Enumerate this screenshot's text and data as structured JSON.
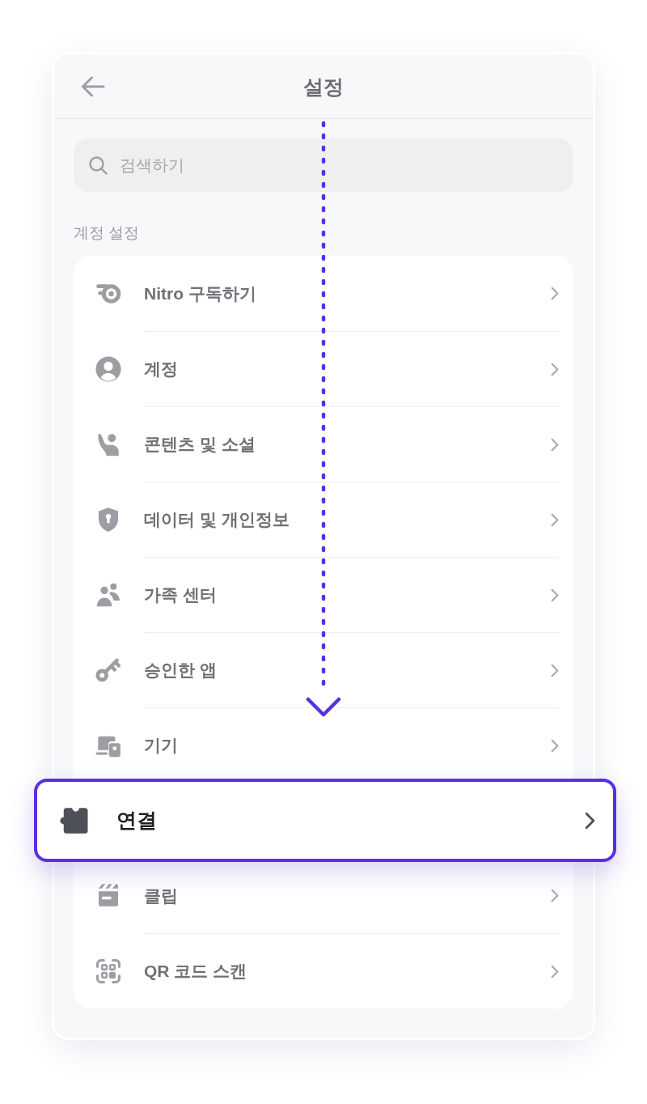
{
  "header": {
    "title": "설정"
  },
  "search": {
    "placeholder": "검색하기"
  },
  "section": {
    "title": "계정 설정",
    "items": [
      {
        "label": "Nitro 구독하기",
        "selected": false
      },
      {
        "label": "계정",
        "selected": false
      },
      {
        "label": "콘텐츠 및 소셜",
        "selected": false
      },
      {
        "label": "데이터 및 개인정보",
        "selected": false
      },
      {
        "label": "가족 센터",
        "selected": false
      },
      {
        "label": "승인한 앱",
        "selected": false
      },
      {
        "label": "기기",
        "selected": false
      },
      {
        "label": "연결",
        "selected": true
      },
      {
        "label": "클립",
        "selected": false
      },
      {
        "label": "QR 코드 스캔",
        "selected": false
      }
    ]
  }
}
